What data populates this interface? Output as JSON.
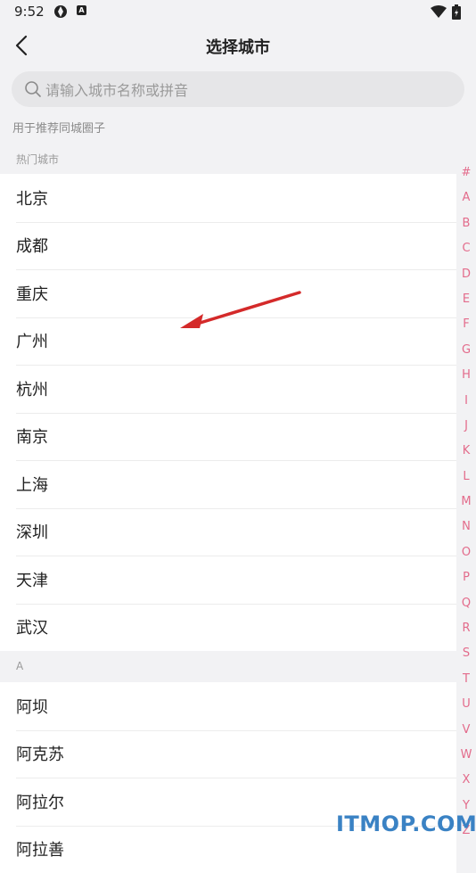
{
  "status_bar": {
    "time": "9:52",
    "icon_a": "aperture-icon",
    "icon_b": "A"
  },
  "header": {
    "title": "选择城市",
    "back_icon": "chevron-left-icon"
  },
  "search": {
    "placeholder": "请输入城市名称或拼音",
    "value": ""
  },
  "hint": "用于推荐同城圈子",
  "sections": [
    {
      "header": "热门城市",
      "cities": [
        "北京",
        "成都",
        "重庆",
        "广州",
        "杭州",
        "南京",
        "上海",
        "深圳",
        "天津",
        "武汉"
      ]
    },
    {
      "header": "A",
      "cities": [
        "阿坝",
        "阿克苏",
        "阿拉尔",
        "阿拉善"
      ]
    }
  ],
  "index_letters": [
    "#",
    "A",
    "B",
    "C",
    "D",
    "E",
    "F",
    "G",
    "H",
    "I",
    "J",
    "K",
    "L",
    "M",
    "N",
    "O",
    "P",
    "Q",
    "R",
    "S",
    "T",
    "U",
    "V",
    "W",
    "X",
    "Y",
    "Z"
  ],
  "colors": {
    "accent": "#e36b8b",
    "background": "#f2f2f4",
    "arrow": "#d42a2a",
    "watermark": "#3a82c4"
  },
  "watermark": "ITMOP.COM"
}
